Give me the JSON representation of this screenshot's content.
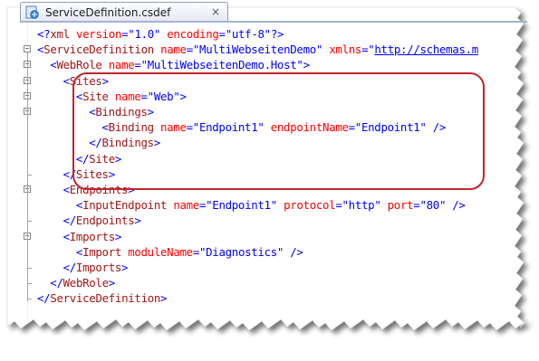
{
  "tab": {
    "title": "ServiceDefinition.csdef",
    "close_glyph": "×"
  },
  "code": {
    "lines": [
      {
        "indent": 0,
        "parts": [
          [
            "punc",
            "<?"
          ],
          [
            "tag",
            "xml"
          ],
          [
            "text",
            " "
          ],
          [
            "attr",
            "version"
          ],
          [
            "punc",
            "=\""
          ],
          [
            "val",
            "1.0"
          ],
          [
            "punc",
            "\" "
          ],
          [
            "attr",
            "encoding"
          ],
          [
            "punc",
            "=\""
          ],
          [
            "val",
            "utf-8"
          ],
          [
            "punc",
            "\"?>"
          ]
        ]
      },
      {
        "indent": 0,
        "parts": [
          [
            "punc",
            "<"
          ],
          [
            "tag",
            "ServiceDefinition"
          ],
          [
            "text",
            " "
          ],
          [
            "attr",
            "name"
          ],
          [
            "punc",
            "=\""
          ],
          [
            "val",
            "MultiWebseitenDemo"
          ],
          [
            "punc",
            "\" "
          ],
          [
            "attr",
            "xmlns"
          ],
          [
            "punc",
            "=\""
          ],
          [
            "url",
            "http://schemas.m"
          ]
        ]
      },
      {
        "indent": 1,
        "parts": [
          [
            "punc",
            "<"
          ],
          [
            "tag",
            "WebRole"
          ],
          [
            "text",
            " "
          ],
          [
            "attr",
            "name"
          ],
          [
            "punc",
            "=\""
          ],
          [
            "val",
            "MultiWebseitenDemo.Host"
          ],
          [
            "punc",
            "\">"
          ]
        ]
      },
      {
        "indent": 2,
        "parts": [
          [
            "punc",
            "<"
          ],
          [
            "tag",
            "Sites"
          ],
          [
            "punc",
            ">"
          ]
        ]
      },
      {
        "indent": 3,
        "parts": [
          [
            "punc",
            "<"
          ],
          [
            "tag",
            "Site"
          ],
          [
            "text",
            " "
          ],
          [
            "attr",
            "name"
          ],
          [
            "punc",
            "=\""
          ],
          [
            "val",
            "Web"
          ],
          [
            "punc",
            "\">"
          ]
        ]
      },
      {
        "indent": 4,
        "parts": [
          [
            "punc",
            "<"
          ],
          [
            "tag",
            "Bindings"
          ],
          [
            "punc",
            ">"
          ]
        ]
      },
      {
        "indent": 5,
        "parts": [
          [
            "punc",
            "<"
          ],
          [
            "tag",
            "Binding"
          ],
          [
            "text",
            " "
          ],
          [
            "attr",
            "name"
          ],
          [
            "punc",
            "=\""
          ],
          [
            "val",
            "Endpoint1"
          ],
          [
            "punc",
            "\" "
          ],
          [
            "attr",
            "endpointName"
          ],
          [
            "punc",
            "=\""
          ],
          [
            "val",
            "Endpoint1"
          ],
          [
            "punc",
            "\" />"
          ]
        ]
      },
      {
        "indent": 4,
        "parts": [
          [
            "punc",
            "</"
          ],
          [
            "tag",
            "Bindings"
          ],
          [
            "punc",
            ">"
          ]
        ]
      },
      {
        "indent": 3,
        "parts": [
          [
            "punc",
            "</"
          ],
          [
            "tag",
            "Site"
          ],
          [
            "punc",
            ">"
          ]
        ]
      },
      {
        "indent": 2,
        "parts": [
          [
            "punc",
            "</"
          ],
          [
            "tag",
            "Sites"
          ],
          [
            "punc",
            ">"
          ]
        ]
      },
      {
        "indent": 2,
        "parts": [
          [
            "punc",
            "<"
          ],
          [
            "tag",
            "Endpoints"
          ],
          [
            "punc",
            ">"
          ]
        ]
      },
      {
        "indent": 3,
        "parts": [
          [
            "punc",
            "<"
          ],
          [
            "tag",
            "InputEndpoint"
          ],
          [
            "text",
            " "
          ],
          [
            "attr",
            "name"
          ],
          [
            "punc",
            "=\""
          ],
          [
            "val",
            "Endpoint1"
          ],
          [
            "punc",
            "\" "
          ],
          [
            "attr",
            "protocol"
          ],
          [
            "punc",
            "=\""
          ],
          [
            "val",
            "http"
          ],
          [
            "punc",
            "\" "
          ],
          [
            "attr",
            "port"
          ],
          [
            "punc",
            "=\""
          ],
          [
            "val",
            "80"
          ],
          [
            "punc",
            "\" />"
          ]
        ]
      },
      {
        "indent": 2,
        "parts": [
          [
            "punc",
            "</"
          ],
          [
            "tag",
            "Endpoints"
          ],
          [
            "punc",
            ">"
          ]
        ]
      },
      {
        "indent": 2,
        "parts": [
          [
            "punc",
            "<"
          ],
          [
            "tag",
            "Imports"
          ],
          [
            "punc",
            ">"
          ]
        ]
      },
      {
        "indent": 3,
        "parts": [
          [
            "punc",
            "<"
          ],
          [
            "tag",
            "Import"
          ],
          [
            "text",
            " "
          ],
          [
            "attr",
            "moduleName"
          ],
          [
            "punc",
            "=\""
          ],
          [
            "val",
            "Diagnostics"
          ],
          [
            "punc",
            "\" />"
          ]
        ]
      },
      {
        "indent": 2,
        "parts": [
          [
            "punc",
            "</"
          ],
          [
            "tag",
            "Imports"
          ],
          [
            "punc",
            ">"
          ]
        ]
      },
      {
        "indent": 1,
        "parts": [
          [
            "punc",
            "</"
          ],
          [
            "tag",
            "WebRole"
          ],
          [
            "punc",
            ">"
          ]
        ]
      },
      {
        "indent": 0,
        "parts": [
          [
            "punc",
            "</"
          ],
          [
            "tag",
            "ServiceDefinition"
          ],
          [
            "punc",
            ">"
          ]
        ]
      }
    ]
  },
  "colors": {
    "highlight": "#c0262c",
    "tag": "#a31515",
    "attribute": "#ff0000",
    "value": "#0000ff"
  }
}
